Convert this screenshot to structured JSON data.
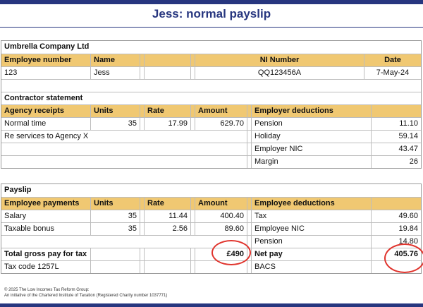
{
  "title": "Jess: normal payslip",
  "company": {
    "name": "Umbrella Company Ltd",
    "headers": {
      "employee_number": "Employee number",
      "name": "Name",
      "ni_number": "NI Number",
      "date": "Date"
    },
    "values": {
      "employee_number": "123",
      "name": "Jess",
      "ni_number": "QQ123456A",
      "date": "7-May-24"
    }
  },
  "contractor": {
    "section_title": "Contractor statement",
    "headers": {
      "receipts": "Agency receipts",
      "units": "Units",
      "rate": "Rate",
      "amount": "Amount",
      "deductions": "Employer deductions"
    },
    "rows": [
      {
        "label": "Normal time",
        "units": "35",
        "rate": "17.99",
        "amount": "629.70"
      },
      {
        "label": "Re services to Agency X"
      }
    ],
    "deductions": [
      {
        "label": "Pension",
        "value": "11.10"
      },
      {
        "label": "Holiday",
        "value": "59.14"
      },
      {
        "label": "Employer NIC",
        "value": "43.47"
      },
      {
        "label": "Margin",
        "value": "26"
      }
    ]
  },
  "payslip": {
    "section_title": "Payslip",
    "headers": {
      "payments": "Employee payments",
      "units": "Units",
      "rate": "Rate",
      "amount": "Amount",
      "deductions": "Employee deductions"
    },
    "rows": [
      {
        "label": "Salary",
        "units": "35",
        "rate": "11.44",
        "amount": "400.40"
      },
      {
        "label": "Taxable bonus",
        "units": "35",
        "rate": "2.56",
        "amount": "89.60"
      }
    ],
    "deductions": [
      {
        "label": "Tax",
        "value": "49.60"
      },
      {
        "label": "Employee NIC",
        "value": "19.84"
      },
      {
        "label": "Pension",
        "value": "14.80"
      }
    ],
    "total_label": "Total gross pay for tax",
    "total_value": "£490",
    "net_label": "Net pay",
    "net_value": "405.76",
    "tax_code": "Tax code 1257L",
    "payment_method": "BACS"
  },
  "footer": {
    "line1": "© 2025 The Low Incomes Tax Reform Group:",
    "line2": "An initiative of the Chartered Institute of Taxation (Registered Charity number 1037771)"
  },
  "colors": {
    "header_fill": "#f0c872",
    "brand_navy": "#27367f",
    "highlight_red": "#e0342d"
  }
}
